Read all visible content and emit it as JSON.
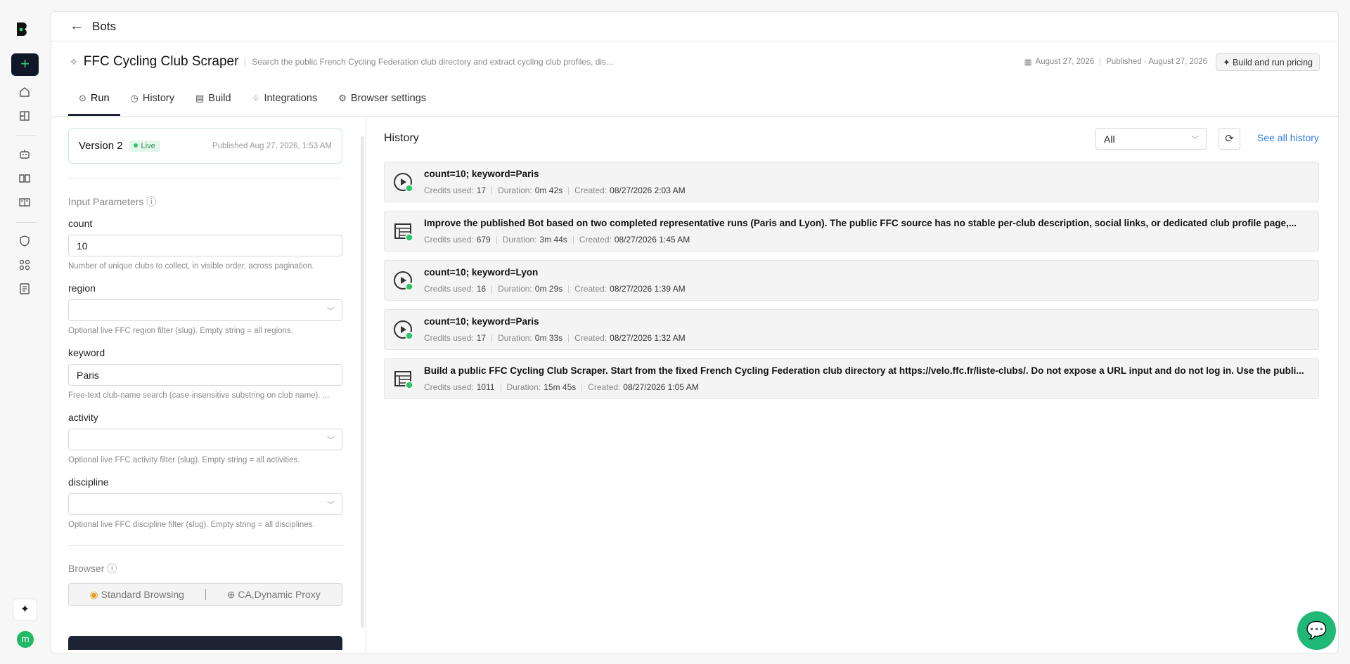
{
  "topbar": {
    "back_label": "Bots"
  },
  "bot": {
    "title": "FFC Cycling Club Scraper",
    "description": "Search the public French Cycling Federation club directory and extract cycling club profiles, dis...",
    "date": "August 27, 2026",
    "published": "Published · August 27, 2026",
    "pricing_label": "Build and run pricing"
  },
  "tabs": [
    {
      "label": "Run",
      "icon": "play-circle-icon"
    },
    {
      "label": "History",
      "icon": "clock-icon"
    },
    {
      "label": "Build",
      "icon": "build-icon"
    },
    {
      "label": "Integrations",
      "icon": "grid-icon"
    },
    {
      "label": "Browser settings",
      "icon": "gear-icon"
    }
  ],
  "version": {
    "label": "Version 2",
    "status": "Live",
    "published": "Published Aug 27, 2026, 1:53 AM"
  },
  "params": {
    "section_label": "Input Parameters",
    "fields": [
      {
        "label": "count",
        "value": "10",
        "help": "Number of unique clubs to collect, in visible order, across pagination."
      },
      {
        "label": "region",
        "value": "",
        "help": "Optional live FFC region filter (slug). Empty string = all regions."
      },
      {
        "label": "keyword",
        "value": "Paris",
        "help": "Free-text club-name search (case-insensitive substring on club name). ..."
      },
      {
        "label": "activity",
        "value": "",
        "help": "Optional live FFC activity filter (slug). Empty string = all activities."
      },
      {
        "label": "discipline",
        "value": "",
        "help": "Optional live FFC discipline filter (slug). Empty string = all disciplines."
      }
    ]
  },
  "browser": {
    "section_label": "Browser",
    "option1": "Standard Browsing",
    "option2": "CA,Dynamic Proxy"
  },
  "history": {
    "title": "History",
    "filter_value": "All",
    "see_all": "See all history",
    "labels": {
      "credits": "Credits used:",
      "duration": "Duration:",
      "created": "Created:"
    },
    "items": [
      {
        "title": "count=10; keyword=Paris",
        "credits": "17",
        "duration": "0m 42s",
        "created": "08/27/2026 2:03 AM",
        "icon": "play-run-icon"
      },
      {
        "title": "Improve the published Bot based on two completed representative runs (Paris and Lyon). The public FFC source has no stable per-club description, social links, or dedicated club profile page,...",
        "credits": "679",
        "duration": "3m 44s",
        "created": "08/27/2026 1:45 AM",
        "icon": "build-run-icon"
      },
      {
        "title": "count=10; keyword=Lyon",
        "credits": "16",
        "duration": "0m 29s",
        "created": "08/27/2026 1:39 AM",
        "icon": "play-run-icon"
      },
      {
        "title": "count=10; keyword=Paris",
        "credits": "17",
        "duration": "0m 33s",
        "created": "08/27/2026 1:32 AM",
        "icon": "play-run-icon"
      },
      {
        "title": "Build a public FFC Cycling Club Scraper. Start from the fixed French Cycling Federation club directory at https://velo.ffc.fr/liste-clubs/. Do not expose a URL input and do not log in. Use the publi...",
        "credits": "1011",
        "duration": "15m 45s",
        "created": "08/27/2026 1:05 AM",
        "icon": "build-run-icon"
      }
    ]
  },
  "user": {
    "avatar_initial": "m"
  },
  "colors": {
    "accent": "#1d2433",
    "brand_green": "#2fd37a",
    "link": "#2f7de1"
  }
}
